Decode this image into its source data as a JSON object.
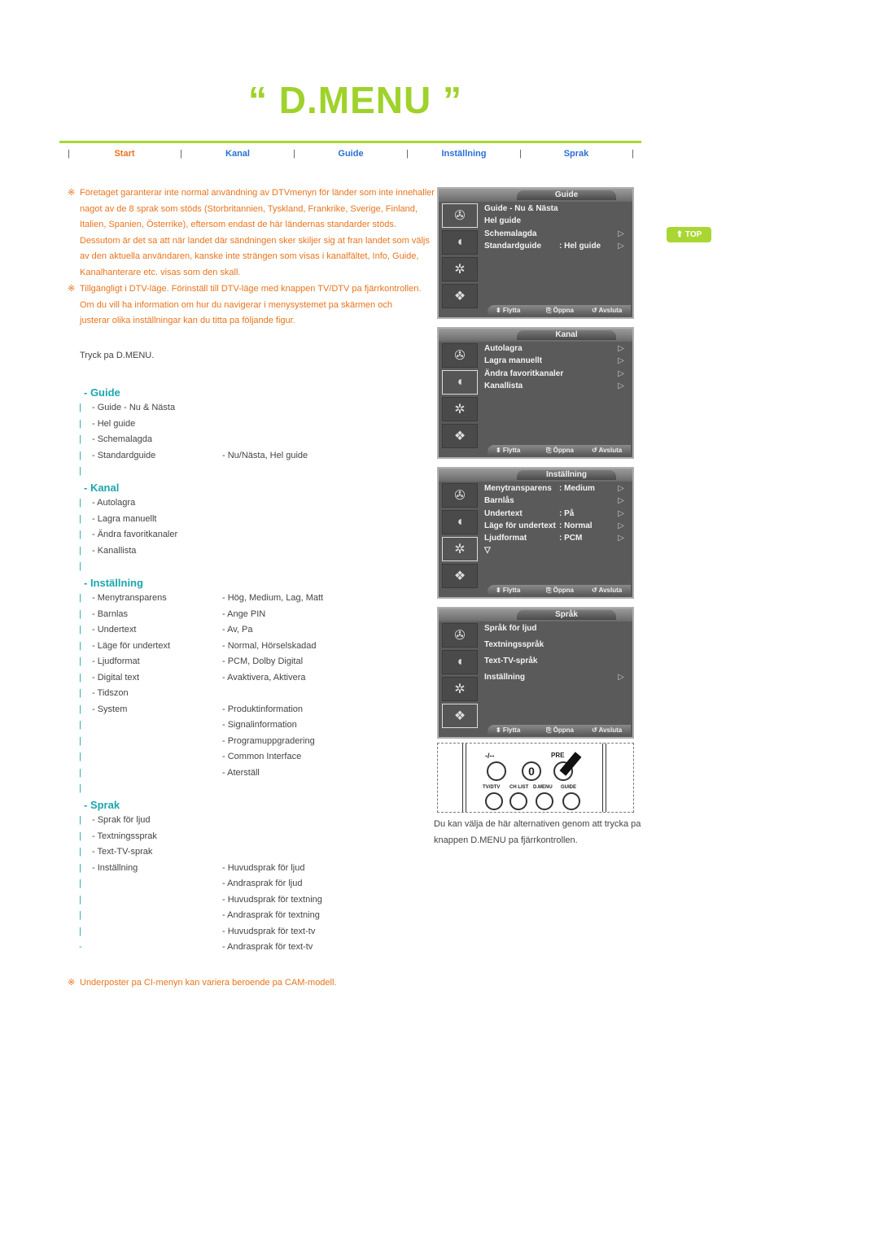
{
  "title": "“ D.MENU ”",
  "nav": {
    "items": [
      {
        "label": "Start",
        "active": true
      },
      {
        "label": "Kanal",
        "active": false
      },
      {
        "label": "Guide",
        "active": false
      },
      {
        "label": "Inställning",
        "active": false
      },
      {
        "label": "Sprak",
        "active": false
      }
    ],
    "separator": "|"
  },
  "notes": {
    "mark": "※",
    "note1": "Företaget garanterar inte normal användning av DTVmenyn för länder som inte innehaller nagot av de 8 sprak som stöds (Storbritannien, Tyskland, Frankrike, Sverige, Finland, Italien, Spanien, Österrike), eftersom endast de här ländernas standarder stöds. Dessutom är det sa att när landet där sändningen sker skiljer sig at fran landet som väljs av den aktuella användaren, kanske inte strängen som visas i kanalfältet, Info, Guide, Kanalhanterare etc. visas som den skall.",
    "note2": "Tillgängligt i DTV-läge. Förinställ till DTV-läge med knappen TV/DTV pa fjärrkontrollen. Om du vill ha information om hur du navigerar i menysystemet pa skärmen och justerar olika inställningar kan du titta pa följande figur.",
    "footer": "Underposter pa CI-menyn kan variera beroende pa CAM-modell."
  },
  "instruction": "Tryck pa D.MENU.",
  "sections": {
    "guide": {
      "heading": "- Guide",
      "rows": [
        {
          "bar": "|",
          "item": "- Guide - Nu & Nästa",
          "options": ""
        },
        {
          "bar": "|",
          "item": "- Hel guide",
          "options": ""
        },
        {
          "bar": "|",
          "item": "- Schemalagda",
          "options": ""
        },
        {
          "bar": "|",
          "item": "- Standardguide",
          "options": "- Nu/Nästa, Hel guide"
        },
        {
          "bar": "|",
          "item": "",
          "options": ""
        }
      ]
    },
    "kanal": {
      "heading": "- Kanal",
      "rows": [
        {
          "bar": "|",
          "item": "- Autolagra",
          "options": ""
        },
        {
          "bar": "|",
          "item": "- Lagra manuellt",
          "options": ""
        },
        {
          "bar": "|",
          "item": "- Ändra favoritkanaler",
          "options": ""
        },
        {
          "bar": "|",
          "item": "- Kanallista",
          "options": ""
        },
        {
          "bar": "|",
          "item": "",
          "options": ""
        }
      ]
    },
    "installning": {
      "heading": "- Inställning",
      "rows": [
        {
          "bar": "|",
          "item": "- Menytransparens",
          "options": "- Hög, Medium, Lag, Matt"
        },
        {
          "bar": "|",
          "item": "- Barnlas",
          "options": "- Ange PIN"
        },
        {
          "bar": "|",
          "item": "- Undertext",
          "options": "- Av, Pa"
        },
        {
          "bar": "|",
          "item": "- Läge för undertext",
          "options": "- Normal, Hörselskadad"
        },
        {
          "bar": "|",
          "item": "- Ljudformat",
          "options": "- PCM, Dolby Digital"
        },
        {
          "bar": "|",
          "item": "- Digital text",
          "options": "- Avaktivera, Aktivera"
        },
        {
          "bar": "|",
          "item": "- Tidszon",
          "options": ""
        },
        {
          "bar": "|",
          "item": "- System",
          "options": "- Produktinformation"
        },
        {
          "bar": "|",
          "item": "",
          "options": "- Signalinformation"
        },
        {
          "bar": "|",
          "item": "",
          "options": "- Programuppgradering"
        },
        {
          "bar": "|",
          "item": "",
          "options": "- Common Interface"
        },
        {
          "bar": "|",
          "item": "",
          "options": "- Aterställ"
        },
        {
          "bar": "|",
          "item": "",
          "options": ""
        }
      ]
    },
    "sprak": {
      "heading": "- Sprak",
      "rows": [
        {
          "bar": "|",
          "item": "- Sprak för ljud",
          "options": ""
        },
        {
          "bar": "|",
          "item": "- Textningssprak",
          "options": ""
        },
        {
          "bar": "|",
          "item": "- Text-TV-sprak",
          "options": ""
        },
        {
          "bar": "|",
          "item": "- Inställning",
          "options": "- Huvudsprak för ljud"
        },
        {
          "bar": "|",
          "item": "",
          "options": "- Andrasprak för ljud"
        },
        {
          "bar": "|",
          "item": "",
          "options": "- Huvudsprak för textning"
        },
        {
          "bar": "|",
          "item": "",
          "options": "- Andrasprak för textning"
        },
        {
          "bar": "|",
          "item": "",
          "options": "- Huvudsprak för text-tv"
        },
        {
          "bar": "-",
          "item": "",
          "options": "- Andrasprak för text-tv"
        }
      ]
    }
  },
  "tv_screens": [
    {
      "tab": "Guide",
      "selected_icon": 0,
      "items": [
        {
          "label": "Guide - Nu & Nästa",
          "value": "",
          "arrow": ""
        },
        {
          "label": "Hel guide",
          "value": "",
          "arrow": ""
        },
        {
          "label": "Schemalagda",
          "value": "",
          "arrow": "▷"
        },
        {
          "label": "Standardguide",
          "value": ": Hel guide",
          "arrow": "▷"
        }
      ]
    },
    {
      "tab": "Kanal",
      "selected_icon": 1,
      "items": [
        {
          "label": "Autolagra",
          "value": "",
          "arrow": "▷"
        },
        {
          "label": "Lagra manuellt",
          "value": "",
          "arrow": "▷"
        },
        {
          "label": "Ändra favoritkanaler",
          "value": "",
          "arrow": "▷"
        },
        {
          "label": "Kanallista",
          "value": "",
          "arrow": "▷"
        }
      ]
    },
    {
      "tab": "Inställning",
      "selected_icon": 2,
      "items": [
        {
          "label": "Menytransparens",
          "value": ": Medium",
          "arrow": "▷"
        },
        {
          "label": "Barnlås",
          "value": "",
          "arrow": "▷"
        },
        {
          "label": "Undertext",
          "value": ": På",
          "arrow": "▷"
        },
        {
          "label": "Läge för undertext",
          "value": ": Normal",
          "arrow": "▷"
        },
        {
          "label": "Ljudformat",
          "value": ": PCM",
          "arrow": "▷"
        },
        {
          "label": "▽",
          "value": "",
          "arrow": ""
        }
      ]
    },
    {
      "tab": "Språk",
      "selected_icon": 3,
      "items": [
        {
          "label": "Språk för ljud",
          "value": "",
          "arrow": ""
        },
        {
          "label": "",
          "value": "",
          "arrow": ""
        },
        {
          "label": "Textningsspråk",
          "value": "",
          "arrow": ""
        },
        {
          "label": "",
          "value": "",
          "arrow": ""
        },
        {
          "label": "Text-TV-språk",
          "value": "",
          "arrow": ""
        },
        {
          "label": "",
          "value": "",
          "arrow": ""
        },
        {
          "label": "Inställning",
          "value": "",
          "arrow": "▷"
        }
      ]
    }
  ],
  "tv_footer": {
    "move": "⬍ Flytta",
    "open": "⎘ Öppna",
    "exit": "↺ Avsluta"
  },
  "tv_icons": [
    "antenna-dish-icon",
    "satellite-icon",
    "gear-icon",
    "speech-icon"
  ],
  "remote": {
    "buttons": [
      "-/--",
      "0",
      "PRE-CH"
    ],
    "labels": [
      "TV/DTV",
      "CH LIST",
      "D.MENU",
      "GUIDE"
    ],
    "top_labels": [
      "-/--",
      "PRE"
    ]
  },
  "caption": "Du kan välja de här alternativen genom att trycka pa knappen D.MENU pa fjärrkontrollen.",
  "top_button": "TOP",
  "colors": {
    "accent_green": "#a9d633",
    "note_orange": "#e8741d",
    "heading_teal": "#1ba6ad",
    "link_blue": "#2a6fd6"
  }
}
